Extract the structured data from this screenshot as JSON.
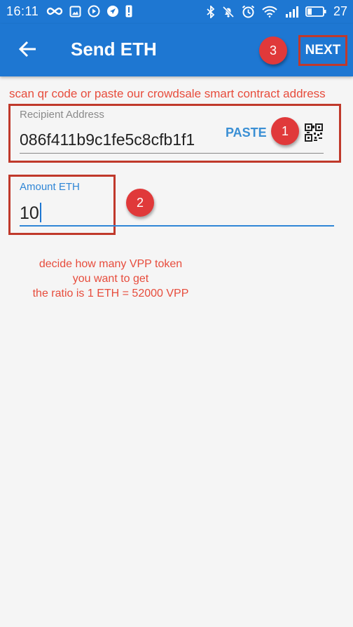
{
  "status_bar": {
    "time": "16:11",
    "battery": "27",
    "left_icons": [
      "infinity-icon",
      "photo-icon",
      "play-icon",
      "location-icon",
      "alert-icon"
    ],
    "right_icons": [
      "bluetooth-icon",
      "mute-icon",
      "alarm-icon",
      "wifi-icon",
      "signal-icon",
      "battery-icon"
    ]
  },
  "app_bar": {
    "title": "Send ETH",
    "next_label": "NEXT"
  },
  "annotations": {
    "instruction": "scan qr code or paste our crowdsale smart contract address",
    "badge_1": "1",
    "badge_2": "2",
    "badge_3": "3",
    "note_lines": [
      "decide how many VPP token",
      "you want to get",
      "the ratio is 1 ETH = 52000 VPP"
    ]
  },
  "recipient": {
    "label": "Recipient Address",
    "value": "086f411b9c1fe5c8cfb1f1",
    "paste_label": "PASTE"
  },
  "amount": {
    "label": "Amount ETH",
    "value": "10"
  },
  "colors": {
    "primary": "#1e77d2",
    "annotation_red": "#e74c3c",
    "frame_red": "#c0392b",
    "paste_blue": "#3a8fd4"
  }
}
